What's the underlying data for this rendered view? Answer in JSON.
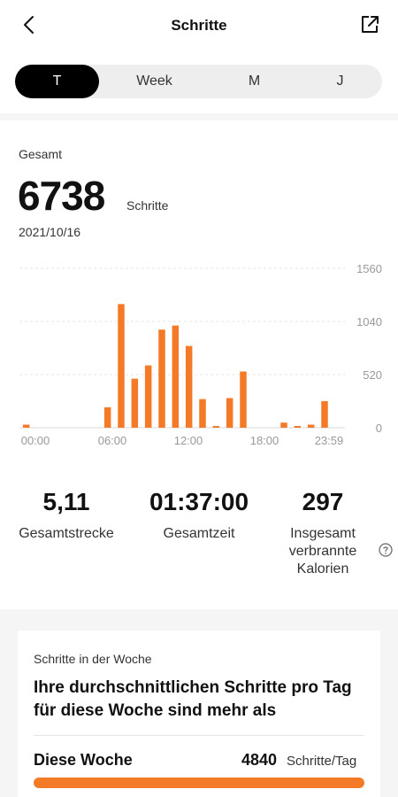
{
  "header": {
    "title": "Schritte"
  },
  "tabs": [
    "T",
    "Week",
    "M",
    "J"
  ],
  "summary": {
    "label": "Gesamt",
    "value": "6738",
    "unit": "Schritte",
    "date": "2021/10/16"
  },
  "chart_data": {
    "type": "bar",
    "color": "#f47a28",
    "ylim": [
      0,
      1560
    ],
    "yticks": [
      "1560",
      "1040",
      "520",
      "0"
    ],
    "ytick_values": [
      1560,
      1040,
      520,
      0
    ],
    "xticks": [
      "00:00",
      "06:00",
      "12:00",
      "18:00",
      "23:59"
    ],
    "categories": [
      "00:00",
      "01:00",
      "02:00",
      "03:00",
      "04:00",
      "05:00",
      "06:00",
      "07:00",
      "08:00",
      "09:00",
      "10:00",
      "11:00",
      "12:00",
      "13:00",
      "14:00",
      "15:00",
      "16:00",
      "17:00",
      "18:00",
      "19:00",
      "20:00",
      "21:00",
      "22:00",
      "23:00"
    ],
    "values": [
      30,
      0,
      0,
      0,
      0,
      0,
      200,
      1210,
      480,
      610,
      960,
      1000,
      800,
      280,
      10,
      290,
      550,
      0,
      0,
      50,
      10,
      30,
      260
    ]
  },
  "stats": [
    {
      "value": "5,11",
      "label": "Gesamtstrecke"
    },
    {
      "value": "01:37:00",
      "label": "Gesamtzeit"
    },
    {
      "value": "297",
      "label": "Insgesamt verbrannte Kalorien"
    }
  ],
  "week": {
    "label": "Schritte in der Woche",
    "headline": "Ihre durchschnittlichen Schritte pro Tag für diese Woche sind mehr als",
    "name": "Diese Woche",
    "value": "4840",
    "unit": "Schritte/Tag"
  },
  "icons": {
    "back": "chevron-left-icon",
    "share": "share-icon",
    "help": "question-circle-icon"
  }
}
